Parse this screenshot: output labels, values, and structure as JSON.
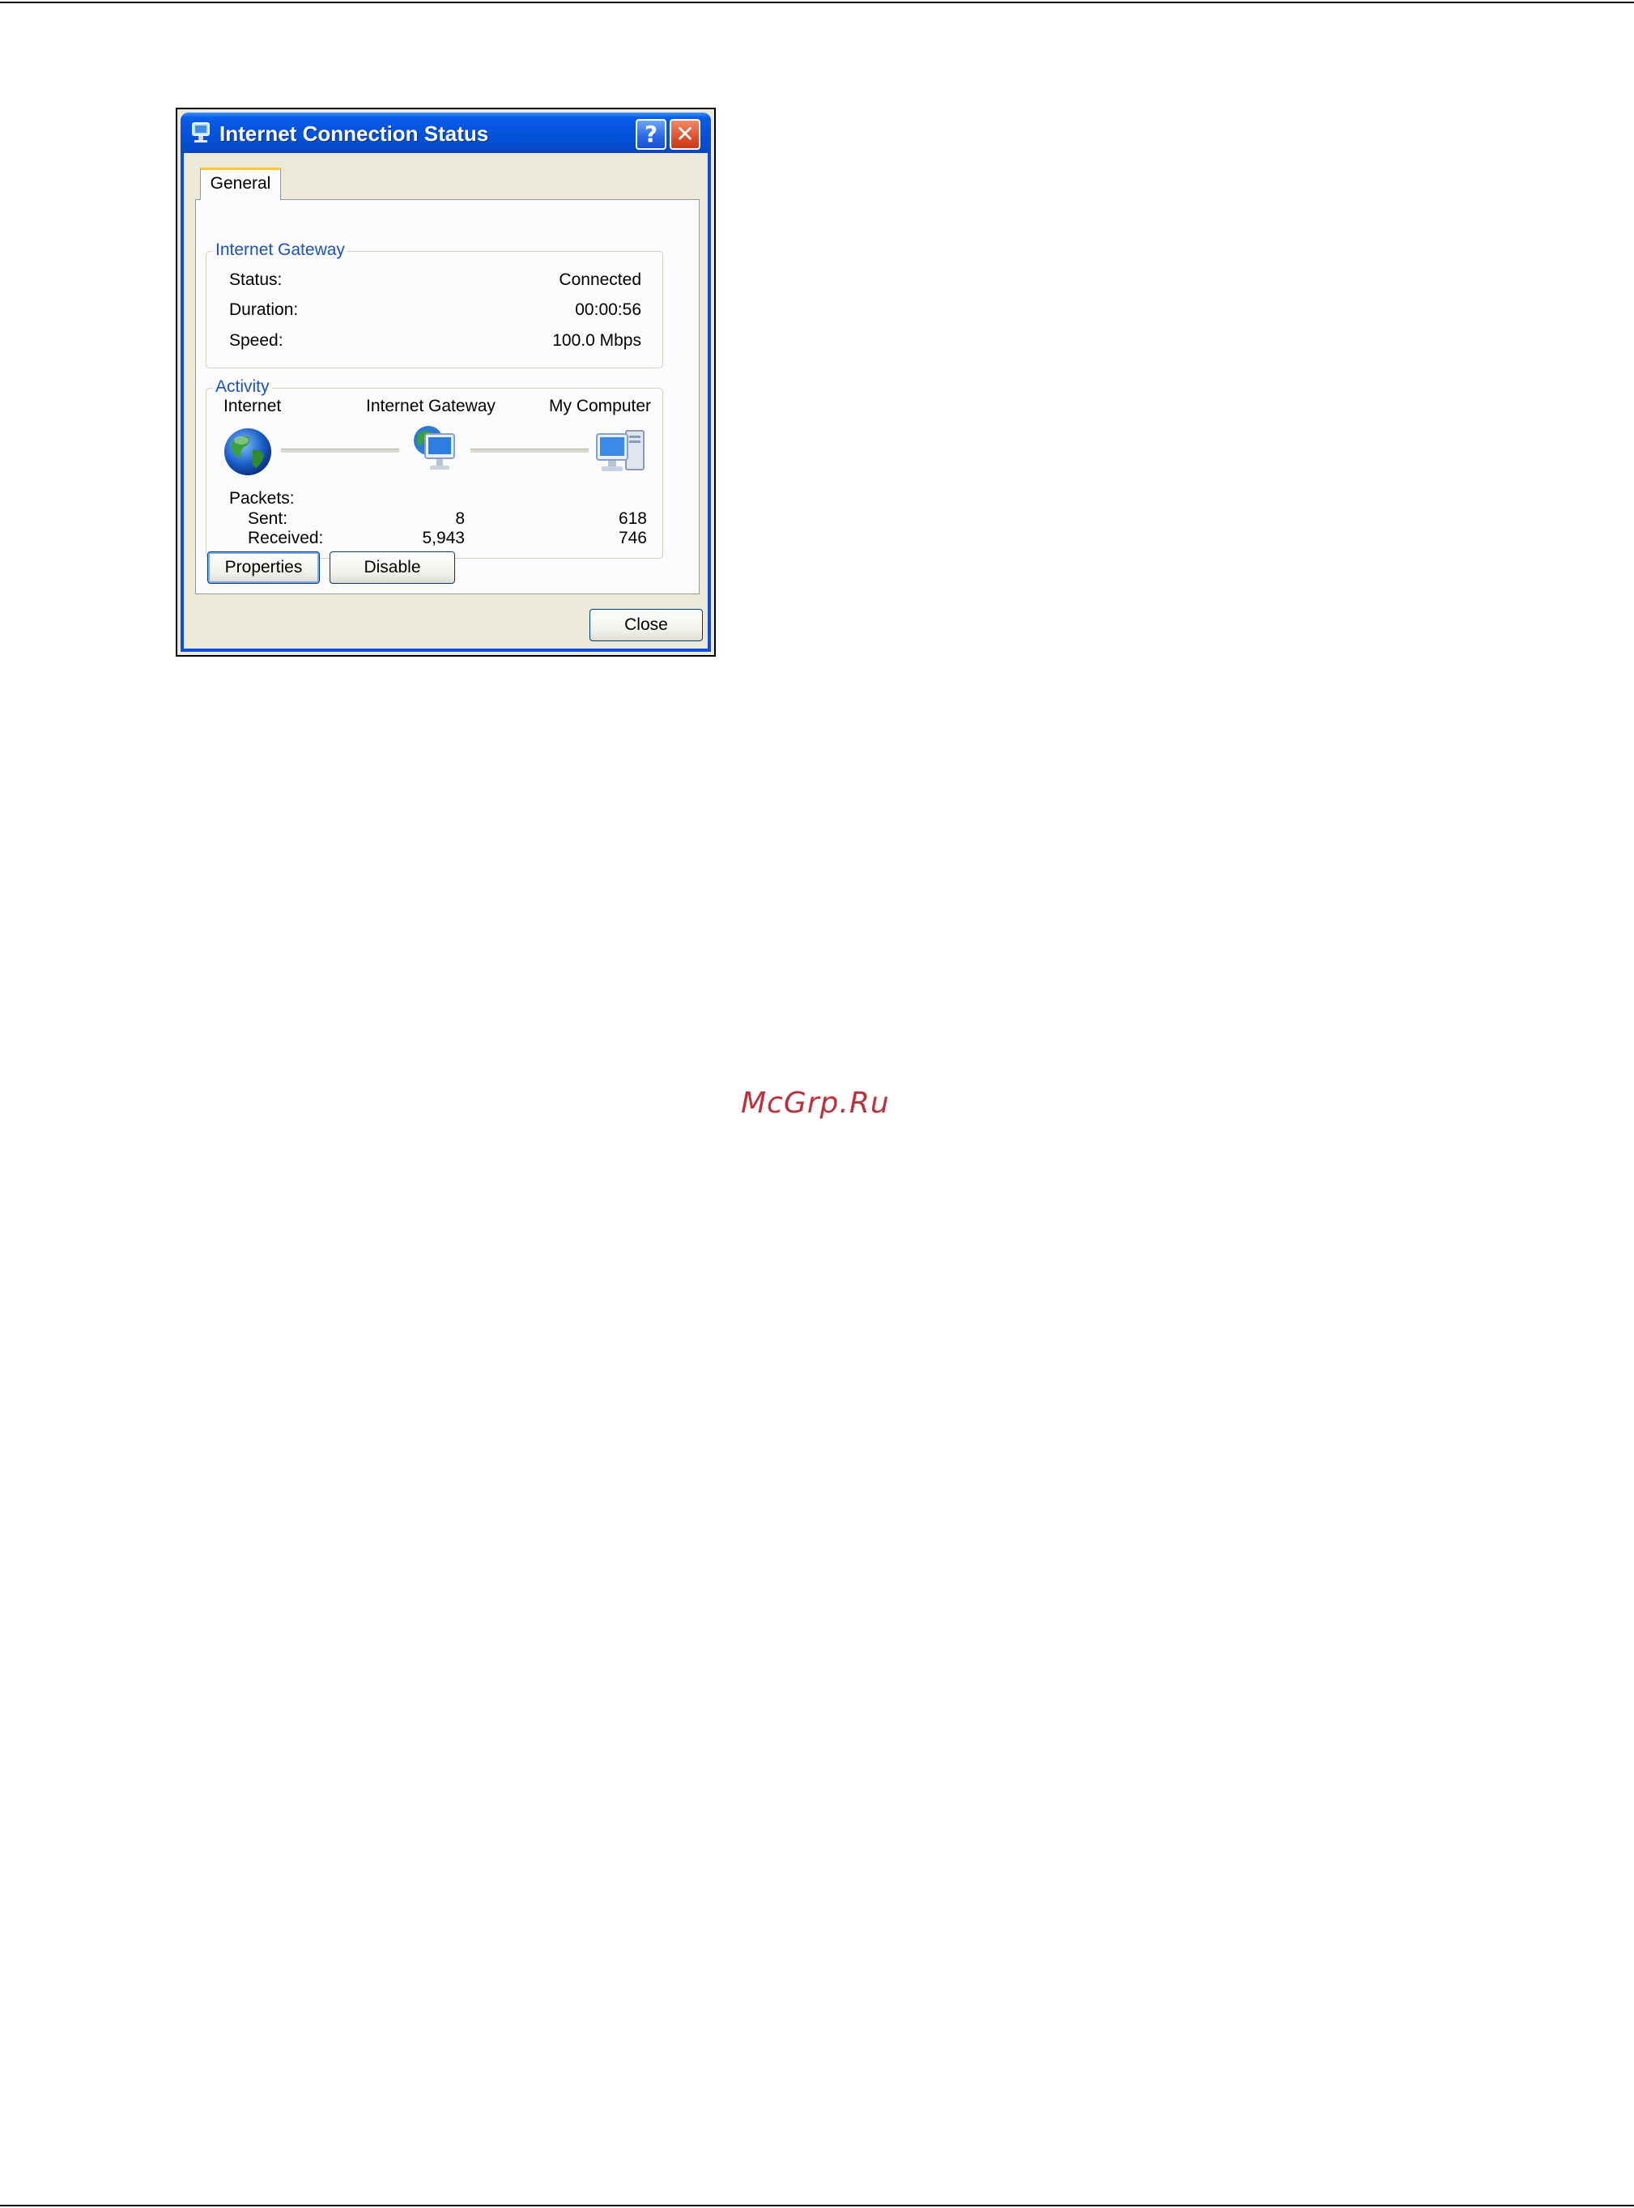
{
  "window": {
    "title": "Internet Connection Status",
    "help_glyph": "?",
    "close_glyph": "✕"
  },
  "tab": {
    "label": "General"
  },
  "gateway_group": {
    "label": "Internet Gateway",
    "rows": [
      {
        "label": "Status:",
        "value": "Connected"
      },
      {
        "label": "Duration:",
        "value": "00:00:56"
      },
      {
        "label": "Speed:",
        "value": "100.0 Mbps"
      }
    ]
  },
  "activity_group": {
    "label": "Activity",
    "nodes": {
      "internet": "Internet",
      "gateway": "Internet Gateway",
      "computer": "My Computer"
    },
    "packets_label": "Packets:",
    "sent_label": "Sent:",
    "received_label": "Received:",
    "sent_gateway": "8",
    "received_gateway": "5,943",
    "sent_computer": "618",
    "received_computer": "746"
  },
  "buttons": {
    "properties": "Properties",
    "disable": "Disable",
    "close": "Close"
  },
  "watermark": "McGrp.Ru",
  "colors": {
    "titlebar": "#0654e0",
    "group_label": "#1a50c8",
    "watermark": "#c0303a",
    "tab_highlight": "#ffc83c"
  },
  "icons": [
    "network-status-icon",
    "help-icon",
    "close-icon",
    "globe-icon",
    "gateway-computer-icon",
    "my-computer-icon"
  ]
}
